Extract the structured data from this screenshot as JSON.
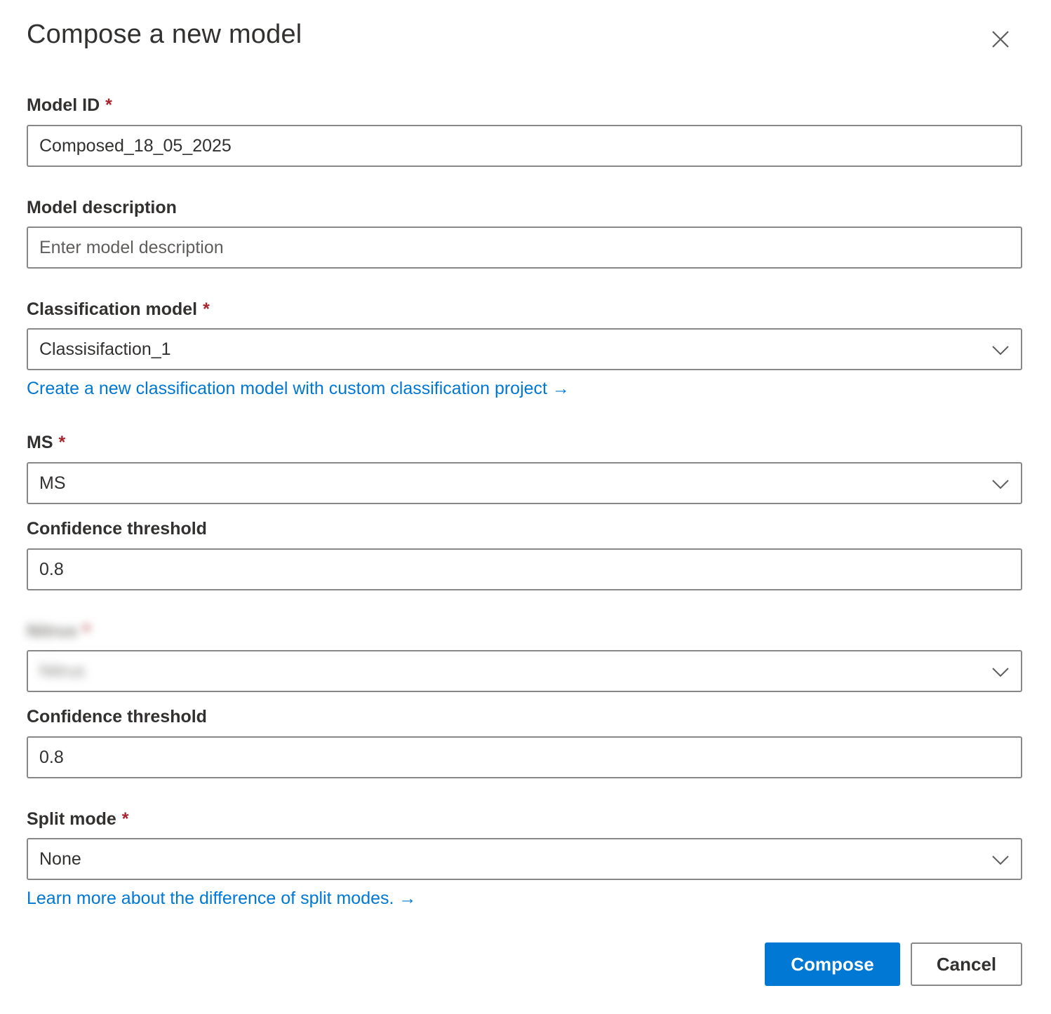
{
  "dialog": {
    "title": "Compose a new model",
    "close_icon": "close-icon"
  },
  "fields": {
    "model_id": {
      "label": "Model ID",
      "required_mark": "*",
      "value": "Composed_18_05_2025"
    },
    "model_description": {
      "label": "Model description",
      "placeholder": "Enter model description",
      "value": ""
    },
    "classification_model": {
      "label": "Classification model",
      "required_mark": "*",
      "selected": "Classisifaction_1",
      "link": "Create a new classification model with custom classification project →"
    },
    "ms": {
      "label": "MS",
      "required_mark": "*",
      "selected": "MS"
    },
    "ms_confidence": {
      "label": "Confidence threshold",
      "value": "0.8"
    },
    "redacted": {
      "label": "Nitrus",
      "required_mark": "*",
      "selected": "Nitrus"
    },
    "redacted_confidence": {
      "label": "Confidence threshold",
      "value": "0.8"
    },
    "split_mode": {
      "label": "Split mode",
      "required_mark": "*",
      "selected": "None",
      "link": "Learn more about the difference of split modes. →"
    }
  },
  "actions": {
    "compose_label": "Compose",
    "cancel_label": "Cancel"
  },
  "colors": {
    "accent": "#0078d4",
    "required": "#a4262c",
    "border": "#8a8886",
    "text": "#323130"
  }
}
